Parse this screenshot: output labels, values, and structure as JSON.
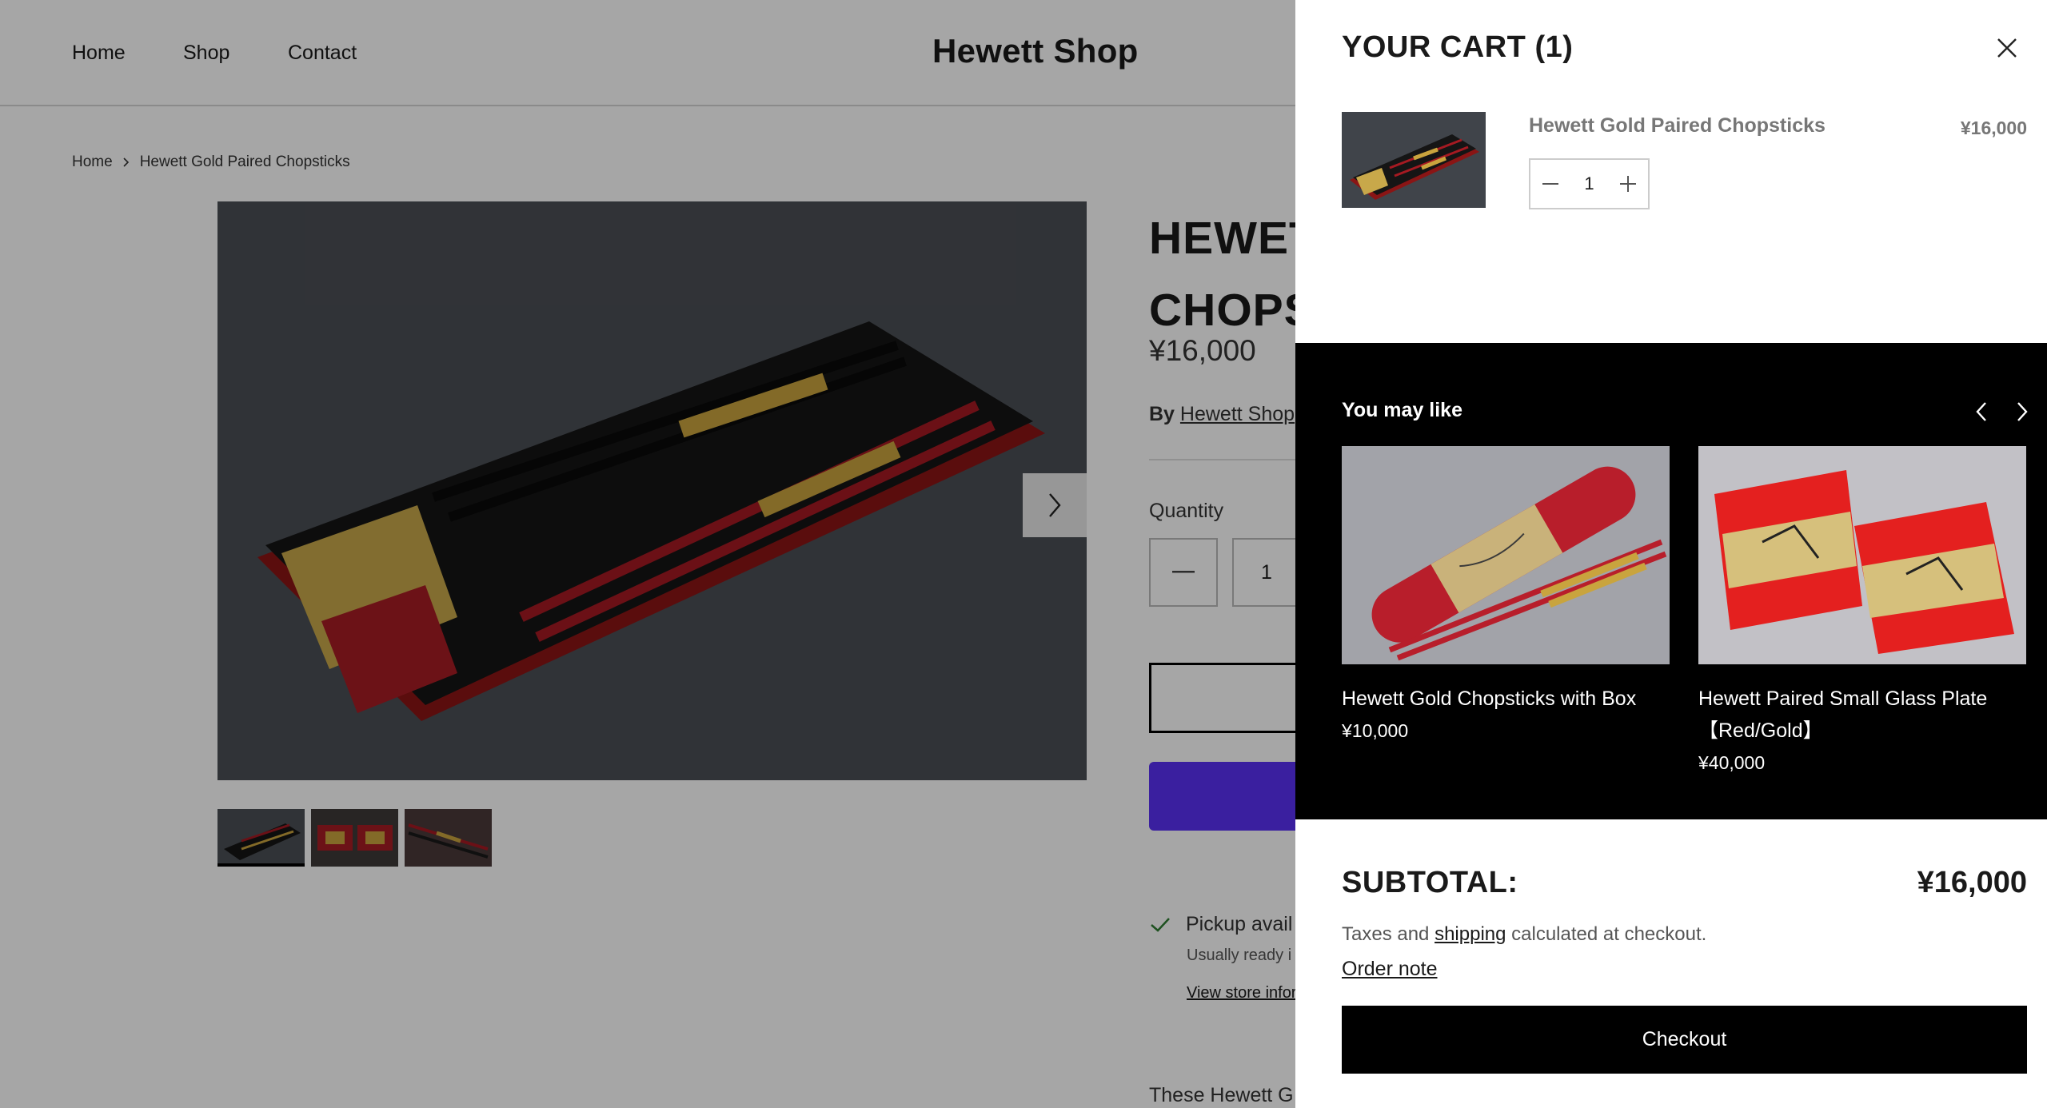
{
  "header": {
    "nav": [
      "Home",
      "Shop",
      "Contact"
    ],
    "brand": "Hewett Shop"
  },
  "breadcrumb": [
    "Home",
    "Hewett Gold Paired Chopsticks"
  ],
  "product": {
    "title_visible": "HEWET\nCHOPS",
    "price": "¥16,000",
    "by_label": "By",
    "vendor": "Hewett Shop",
    "quantity_label": "Quantity",
    "quantity": "1",
    "pickup": "Pickup avail",
    "pickup_sub": "Usually ready i",
    "store_link": "View store infor",
    "description": "These Hewett G"
  },
  "cart": {
    "title": "YOUR CART (1)",
    "item": {
      "name": "Hewett Gold Paired Chopsticks",
      "price": "¥16,000",
      "quantity": "1"
    },
    "reco_title": "You may like",
    "recommendations": [
      {
        "name": "Hewett Gold Chopsticks with Box",
        "price": "¥10,000"
      },
      {
        "name": "Hewett Paired Small Glass Plate 【Red/Gold】",
        "price": "¥40,000"
      }
    ],
    "subtotal_label": "SUBTOTAL:",
    "subtotal_value": "¥16,000",
    "tax_prefix": "Taxes and",
    "tax_link": "shipping",
    "tax_suffix": "calculated at checkout.",
    "order_note": "Order note",
    "checkout_label": "Checkout"
  }
}
